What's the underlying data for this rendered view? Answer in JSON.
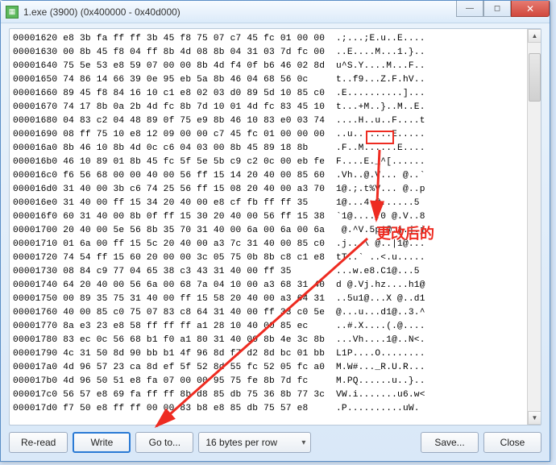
{
  "window": {
    "title": "1.exe (3900) (0x400000 - 0x40d000)"
  },
  "toolbar": {
    "reread": "Re-read",
    "write": "Write",
    "goto": "Go to...",
    "bytes_per_row": "16 bytes per row",
    "save": "Save...",
    "close": "Close"
  },
  "annotation_text": "更改后的",
  "hex_rows": [
    {
      "a": "00001620",
      "b": "e8 3b fa ff ff 3b 45 f8 75 07 c7 45 fc 01 00 00",
      "c": ".;...;E.u..E...."
    },
    {
      "a": "00001630",
      "b": "00 8b 45 f8 04 ff 8b 4d 08 8b 04 31 03 7d fc 00",
      "c": "..E....M...1.}.."
    },
    {
      "a": "00001640",
      "b": "75 5e 53 e8 59 07 00 00 8b 4d f4 0f b6 46 02 8d",
      "c": "u^S.Y....M...F.."
    },
    {
      "a": "00001650",
      "b": "74 86 14 66 39 0e 95 eb 5a 8b 46 04 68 56 0c",
      "c": "t..f9...Z.F.hV.."
    },
    {
      "a": "00001660",
      "b": "89 45 f8 84 16 10 c1 e8 02 03 d0 89 5d 10 85 c0",
      "c": ".E..........]..."
    },
    {
      "a": "00001670",
      "b": "74 17 8b 0a 2b 4d fc 8b 7d 10 01 4d fc 83 45 10",
      "c": "t...+M..}..M..E."
    },
    {
      "a": "00001680",
      "b": "04 83 c2 04 48 89 0f 75 e9 8b 46 10 83 e0 03 74",
      "c": "....H..u..F....t"
    },
    {
      "a": "00001690",
      "b": "08 ff 75 10 e8 12 09 00 00 c7 45 fc 01 00 00 00",
      "c": "..u.......E....."
    },
    {
      "a": "000016a0",
      "b": "8b 46 10 8b 4d 0c c6 04 03 00 8b 45 89 18 8b",
      "c": ".F..M......E...."
    },
    {
      "a": "000016b0",
      "b": "46 10 89 01 8b 45 fc 5f 5e 5b c9 c2 0c 00 eb fe",
      "c": "F....E._^[......"
    },
    {
      "a": "000016c0",
      "b": "f6 56 68 00 00 40 00 56 ff 15 14 20 40 00 85 60",
      "c": ".Vh..@.V... @..`"
    },
    {
      "a": "000016d0",
      "b": "31 40 00 3b c6 74 25 56 ff 15 08 20 40 00 a3 70",
      "c": "1@.;.t%V... @..p"
    },
    {
      "a": "000016e0",
      "b": "31 40 00 ff 15 34 20 40 00 e8 cf fb ff ff 35",
      "c": "1@...4 @......5"
    },
    {
      "a": "000016f0",
      "b": "60 31 40 00 8b 0f ff 15 30 20 40 00 56 ff 15 38",
      "c": "`1@.....0 @.V..8"
    },
    {
      "a": "00001700",
      "b": "20 40 00 5e 56 8b 35 70 31 40 00 6a 00 6a 00 6a",
      "c": " @.^V.5p1@.j.j.j"
    },
    {
      "a": "00001710",
      "b": "01 6a 00 ff 15 5c 20 40 00 a3 7c 31 40 00 85 c0",
      "c": ".j...\\ @..|1@..."
    },
    {
      "a": "00001720",
      "b": "74 54 ff 15 60 20 00 00 3c 05 75 0b 8b c8 c1 e8",
      "c": "tT..` ..<.u....."
    },
    {
      "a": "00001730",
      "b": "08 84 c9 77 04 65 38 c3 43 31 40 00 ff 35",
      "c": "...w.e8.C1@...5"
    },
    {
      "a": "00001740",
      "b": "64 20 40 00 56 6a 00 68 7a 04 10 00 a3 68 31 40",
      "c": "d @.Vj.hz....h1@"
    },
    {
      "a": "00001750",
      "b": "00 89 35 75 31 40 00 ff 15 58 20 40 00 a3 64 31",
      "c": "..5u1@...X @..d1"
    },
    {
      "a": "00001760",
      "b": "40 00 85 c0 75 07 83 c8 64 31 40 00 ff 33 c0 5e",
      "c": "@...u...d1@..3.^"
    },
    {
      "a": "00001770",
      "b": "8a e3 23 e8 58 ff ff ff a1 28 10 40 00 85 ec",
      "c": "..#.X....(.@...."
    },
    {
      "a": "00001780",
      "b": "83 ec 0c 56 68 b1 f0 a1 80 31 40 00 8b 4e 3c 8b",
      "c": "...Vh....1@..N<."
    },
    {
      "a": "00001790",
      "b": "4c 31 50 8d 90 bb b1 4f 96 8d f7 d2 8d bc 01 bb",
      "c": "L1P....O........"
    },
    {
      "a": "000017a0",
      "b": "4d 96 57 23 ca 8d ef 5f 52 8d 55 fc 52 05 fc a0",
      "c": "M.W#..._R.U.R..."
    },
    {
      "a": "000017b0",
      "b": "4d 96 50 51 e8 fa 07 00 00 95 75 fe 8b 7d fc",
      "c": "M.PQ......u..}.."
    },
    {
      "a": "000017c0",
      "b": "56 57 e8 69 fa ff ff 8b d8 85 db 75 36 8b 77 3c",
      "c": "VW.i.......u6.w<"
    },
    {
      "a": "000017d0",
      "b": "f7 50 e8 ff ff 00 00 83 b8 e8 85 db 75 57 e8",
      "c": ".P..........uW."
    }
  ]
}
